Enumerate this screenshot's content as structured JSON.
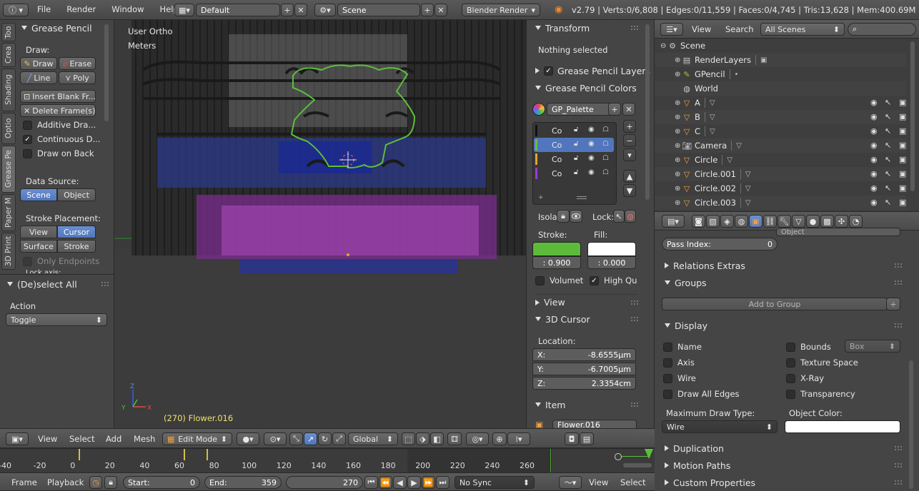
{
  "topbar": {
    "menus": [
      "File",
      "Render",
      "Window",
      "Help"
    ],
    "layout": "Default",
    "scene": "Scene",
    "engine": "Blender Render",
    "stats": "v2.79 | Verts:0/6,808 | Edges:0/11,559 | Faces:0/4,745 | Tris:13,628 | Mem:400.69M | Flower.0"
  },
  "tool_tabs": [
    "Too",
    "Crea",
    "Shading",
    "Optio",
    "Grease Pe",
    "Paper M",
    "3D Print"
  ],
  "grease_panel": {
    "title": "Grease Pencil",
    "draw_label": "Draw:",
    "draw": "Draw",
    "erase": "Erase",
    "line": "Line",
    "poly": "Poly",
    "insert_blank": "Insert Blank Fr...",
    "delete_frames": "Delete Frame(s)",
    "additive": "Additive Dra...",
    "continuous": "Continuous D...",
    "draw_on_back": "Draw on Back",
    "data_source_label": "Data Source:",
    "scene": "Scene",
    "object": "Object",
    "stroke_placement_label": "Stroke Placement:",
    "view": "View",
    "cursor": "Cursor",
    "surface": "Surface",
    "stroke": "Stroke",
    "only_endpoints": "Only Endpoints",
    "lock_axis": "Lock axis:"
  },
  "operator_panel": {
    "title": "(De)select All",
    "action_label": "Action",
    "action_value": "Toggle"
  },
  "viewport": {
    "view_name": "User Ortho",
    "units": "Meters",
    "object_info": "(270) Flower.016"
  },
  "props_n": {
    "transform_title": "Transform",
    "nothing_selected": "Nothing selected",
    "gp_layers": "Grease Pencil Layers",
    "gp_colors": "Grease Pencil Colors",
    "palette": "GP_Palette",
    "colors": [
      {
        "name": "Co",
        "swatch": "#111111"
      },
      {
        "name": "Co",
        "swatch": "#6abf3a"
      },
      {
        "name": "Co",
        "swatch": "#e8a038"
      },
      {
        "name": "Co",
        "swatch": "#9b3bd6"
      }
    ],
    "isolate": "Isola",
    "lock": "Lock:",
    "stroke_label": "Stroke:",
    "fill_label": "Fill:",
    "stroke_color": "#5dbb3b",
    "fill_color": "#ffffff",
    "stroke_alpha": ": 0.900",
    "fill_alpha": ": 0.000",
    "volumetric": "Volumet",
    "high_quality": "High Qu",
    "view_title": "View",
    "cursor_title": "3D Cursor",
    "location_label": "Location:",
    "x": "-8.6555µm",
    "y": "-6.7005µm",
    "z": "2.3354cm",
    "item_title": "Item",
    "item_name": "Flower.016"
  },
  "outliner": {
    "view": "View",
    "search": "Search",
    "filter": "All Scenes",
    "rows": [
      {
        "name": "Scene",
        "indent": 0
      },
      {
        "name": "RenderLayers",
        "indent": 1
      },
      {
        "name": "GPencil",
        "indent": 1
      },
      {
        "name": "World",
        "indent": 1
      },
      {
        "name": "A",
        "indent": 1
      },
      {
        "name": "B",
        "indent": 1
      },
      {
        "name": "C",
        "indent": 1
      },
      {
        "name": "Camera",
        "indent": 1
      },
      {
        "name": "Circle",
        "indent": 1
      },
      {
        "name": "Circle.001",
        "indent": 1
      },
      {
        "name": "Circle.002",
        "indent": 1
      },
      {
        "name": "Circle.003",
        "indent": 1
      }
    ]
  },
  "properties": {
    "partial_top": "Object",
    "pass_index_label": "Pass Index:",
    "pass_index": "0",
    "relations_extras": "Relations Extras",
    "groups": "Groups",
    "add_to_group": "Add to Group",
    "display": "Display",
    "name": "Name",
    "bounds": "Bounds",
    "bounds_type": "Box",
    "axis": "Axis",
    "texture_space": "Texture Space",
    "wire": "Wire",
    "xray": "X-Ray",
    "draw_all_edges": "Draw All Edges",
    "transparency": "Transparency",
    "max_draw_type_label": "Maximum Draw Type:",
    "max_draw_type": "Wire",
    "object_color_label": "Object Color:",
    "duplication": "Duplication",
    "motion_paths": "Motion Paths",
    "custom_properties": "Custom Properties"
  },
  "view3d_header": {
    "view": "View",
    "select": "Select",
    "add": "Add",
    "mesh": "Mesh",
    "mode": "Edit Mode",
    "orientation": "Global"
  },
  "timeline": {
    "ticks": [
      "-40",
      "-20",
      "0",
      "20",
      "40",
      "60",
      "80",
      "100",
      "120",
      "140",
      "160",
      "180",
      "200",
      "220",
      "240",
      "260"
    ],
    "frame": "Frame",
    "playback": "Playback",
    "start": "Start:",
    "start_val": "0",
    "end": "End:",
    "end_val": "359",
    "current": "270",
    "sync": "No Sync",
    "view": "View",
    "select": "Select"
  }
}
